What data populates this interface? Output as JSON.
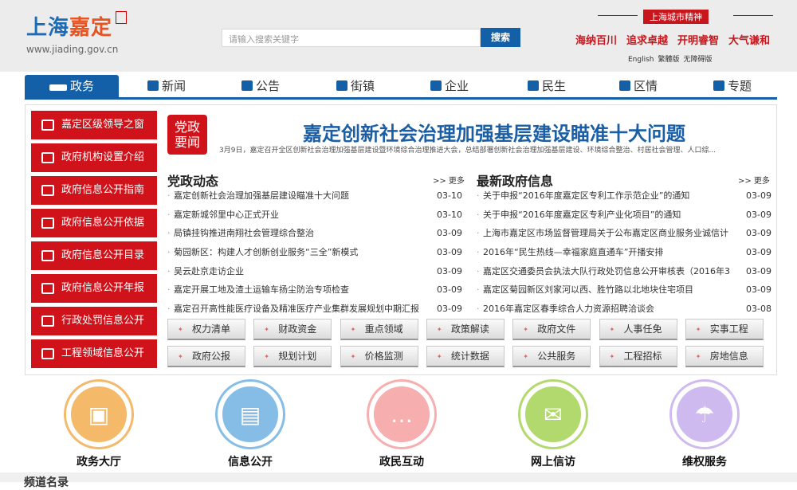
{
  "header": {
    "logo_text": "上海",
    "logo_brand": "嘉定",
    "logo_url": "www.jiading.gov.cn",
    "search_placeholder": "请输入搜索关键字",
    "search_button": "搜索",
    "spirit_title": "上海城市精神",
    "mottos": [
      "海纳百川",
      "追求卓越",
      "开明睿智",
      "大气谦和"
    ],
    "langs": [
      "English",
      "繁體版",
      "无障碍版"
    ]
  },
  "nav": [
    {
      "label": "政务"
    },
    {
      "label": "新闻"
    },
    {
      "label": "公告"
    },
    {
      "label": "街镇"
    },
    {
      "label": "企业"
    },
    {
      "label": "民生"
    },
    {
      "label": "区情"
    },
    {
      "label": "专题"
    }
  ],
  "sidebar": [
    "嘉定区级领导之窗",
    "政府机构设置介绍",
    "政府信息公开指南",
    "政府信息公开依据",
    "政府信息公开目录",
    "政府信息公开年报",
    "行政处罚信息公开",
    "工程领域信息公开"
  ],
  "headline": {
    "badge_1": "党政",
    "badge_2": "要闻",
    "title": "嘉定创新社会治理加强基层建设瞄准十大问题",
    "summary": "3月9日，嘉定召开全区创新社会治理加强基层建设暨环境综合治理推进大会，总结部署创新社会治理加强基层建设、环境综合整治、村居社会管理、人口综..."
  },
  "left_list": {
    "title": "党政动态",
    "more": ">> 更多",
    "items": [
      {
        "text": "嘉定创新社会治理加强基层建设瞄准十大问题",
        "date": "03-10"
      },
      {
        "text": "嘉定新城邻里中心正式开业",
        "date": "03-10"
      },
      {
        "text": "局镇挂钩推进南翔社会管理综合整治",
        "date": "03-09"
      },
      {
        "text": "菊园新区：构建人才创新创业服务“三全”新模式",
        "date": "03-09"
      },
      {
        "text": "吴云赴京走访企业",
        "date": "03-09"
      },
      {
        "text": "嘉定开展工地及渣土运输车扬尘防治专项检查",
        "date": "03-09"
      },
      {
        "text": "嘉定召开高性能医疗设备及精准医疗产业集群发展规划中期汇报",
        "date": "03-09"
      }
    ]
  },
  "right_list": {
    "title": "最新政府信息",
    "more": ">> 更多",
    "items": [
      {
        "text": "关于申报“2016年度嘉定区专利工作示范企业”的通知",
        "date": "03-09"
      },
      {
        "text": "关于申报“2016年度嘉定区专利产业化项目”的通知",
        "date": "03-09"
      },
      {
        "text": "上海市嘉定区市场监督管理局关于公布嘉定区商业服务业诚信计",
        "date": "03-09"
      },
      {
        "text": "2016年“民生热线—幸福家庭直通车”开播安排",
        "date": "03-09"
      },
      {
        "text": "嘉定区交通委员会执法大队行政处罚信息公开审核表（2016年3",
        "date": "03-09"
      },
      {
        "text": "嘉定区菊园新区刘家河以西、胜竹路以北地块住宅项目",
        "date": "03-09"
      },
      {
        "text": "2016年嘉定区春季综合人力资源招聘洽谈会",
        "date": "03-08"
      }
    ]
  },
  "quick_buttons": [
    "权力清单",
    "财政资金",
    "重点领域",
    "政策解读",
    "政府文件",
    "人事任免",
    "实事工程",
    "政府公报",
    "规划计划",
    "价格监测",
    "统计数据",
    "公共服务",
    "工程招标",
    "房地信息"
  ],
  "services": [
    {
      "label": "政务大厅",
      "icon": "computer-icon",
      "color": "#f5b96a",
      "glyph": "▣"
    },
    {
      "label": "信息公开",
      "icon": "message-icon",
      "color": "#86bde6",
      "glyph": "▤"
    },
    {
      "label": "政民互动",
      "icon": "chat-icon",
      "color": "#f7aeae",
      "glyph": "…"
    },
    {
      "label": "网上信访",
      "icon": "mail-icon",
      "color": "#b2d96e",
      "glyph": "✉"
    },
    {
      "label": "维权服务",
      "icon": "umbrella-icon",
      "color": "#cfbaf0",
      "glyph": "☂"
    }
  ],
  "footer": {
    "section_title": "频道名录"
  }
}
